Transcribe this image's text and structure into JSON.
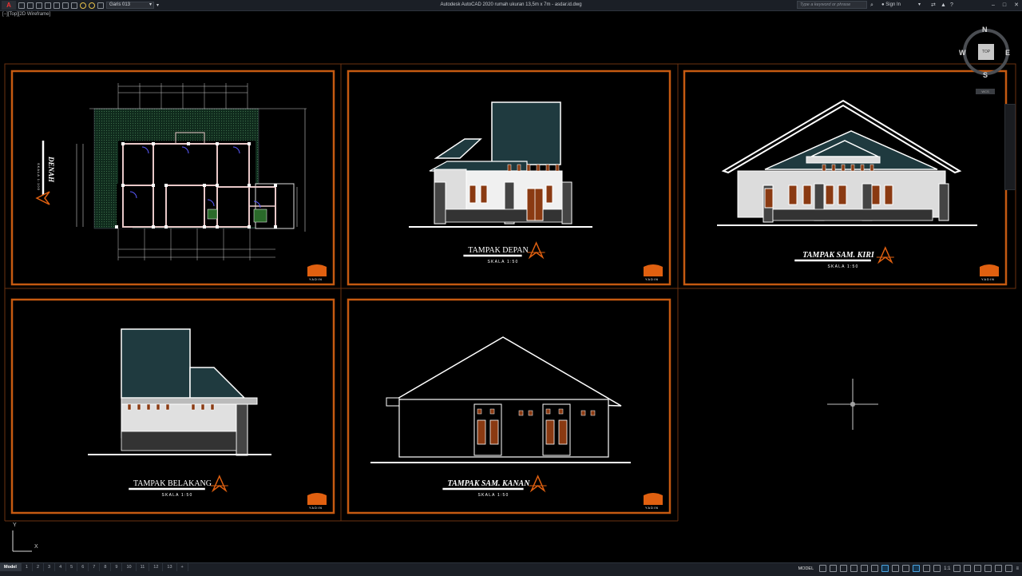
{
  "app": {
    "title": "Autodesk AutoCAD 2020    rumah ukuran 13,5m x 7m - asdar.id.dwg",
    "app_letter": "A",
    "layer_name": "Garis 013",
    "search_placeholder": "Type a keyword or phrase",
    "sign_in": "Sign In",
    "view_label": "[−][Top][2D Wireframe]"
  },
  "viewcube": {
    "north": "N",
    "south": "S",
    "east": "E",
    "west": "W",
    "face": "TOP",
    "wcs": "WCS"
  },
  "ucs": {
    "x": "X",
    "y": "Y"
  },
  "colors": {
    "frame": "#c55a11",
    "bg": "#000000",
    "line": "#ffffff",
    "roof": "#1f3a3f",
    "door": "#8a3a12",
    "accent": "#e06010"
  },
  "sheets": [
    {
      "title": "DENAH",
      "scale": "SKALA 1:100"
    },
    {
      "title": "TAMPAK DEPAN",
      "scale": "SKALA 1:50"
    },
    {
      "title": "TAMPAK SAM. KIRI",
      "scale": "SKALA 1:50"
    },
    {
      "title": "TAMPAK  BELAKANG",
      "scale": "SKALA 1:50"
    },
    {
      "title": "TAMPAK SAM. KANAN",
      "scale": "SKALA 1:50"
    }
  ],
  "logo_text": "YADIN",
  "status": {
    "tabs": [
      "Model",
      "1",
      "2",
      "3",
      "4",
      "5",
      "6",
      "7",
      "8",
      "9",
      "10",
      "11",
      "12",
      "13",
      "+"
    ],
    "model_button": "MODEL",
    "scale": "1:1"
  }
}
